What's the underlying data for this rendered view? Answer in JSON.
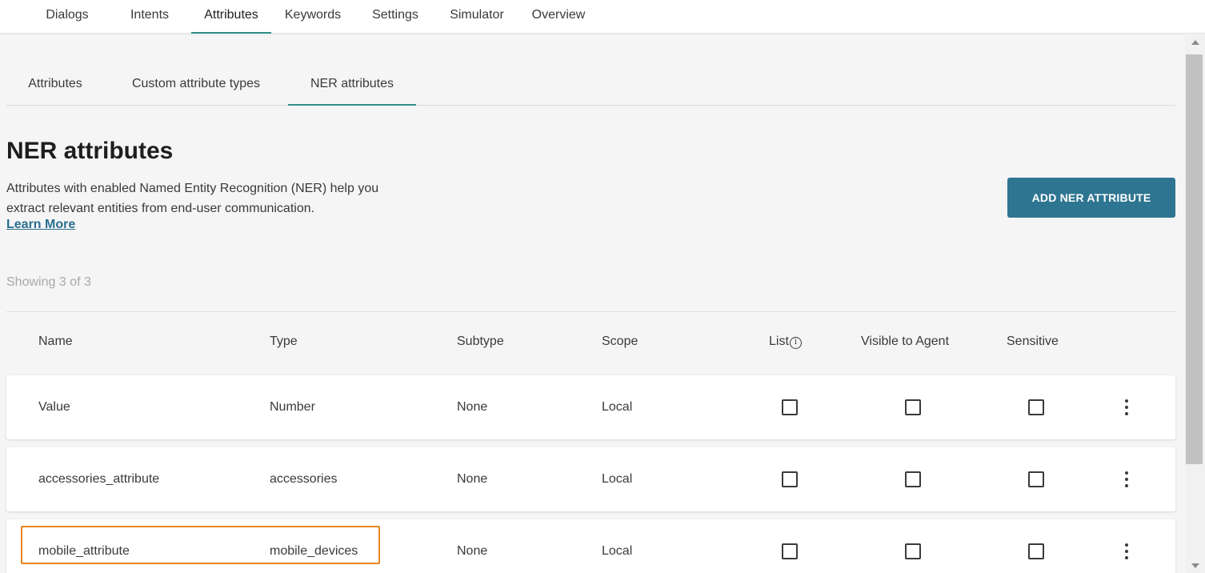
{
  "top_nav": {
    "tabs": [
      {
        "label": "Dialogs"
      },
      {
        "label": "Intents"
      },
      {
        "label": "Attributes"
      },
      {
        "label": "Keywords"
      },
      {
        "label": "Settings"
      },
      {
        "label": "Simulator"
      },
      {
        "label": "Overview"
      }
    ],
    "active": "Attributes"
  },
  "sub_tabs": {
    "tabs": [
      {
        "label": "Attributes"
      },
      {
        "label": "Custom attribute types"
      },
      {
        "label": "NER attributes"
      }
    ],
    "active": "NER attributes"
  },
  "page": {
    "title": "NER attributes",
    "description_line1": "Attributes with enabled Named Entity Recognition (NER) help you",
    "description_line2": "extract relevant entities from end-user communication.",
    "learn_more": "Learn More",
    "add_button": "ADD NER ATTRIBUTE",
    "showing": "Showing 3 of 3"
  },
  "table": {
    "headers": {
      "name": "Name",
      "type": "Type",
      "subtype": "Subtype",
      "scope": "Scope",
      "list": "List",
      "visible": "Visible to Agent",
      "sensitive": "Sensitive"
    },
    "rows": [
      {
        "name": "Value",
        "type": "Number",
        "subtype": "None",
        "scope": "Local",
        "list": false,
        "visible": false,
        "sensitive": false
      },
      {
        "name": "accessories_attribute",
        "type": "accessories",
        "subtype": "None",
        "scope": "Local",
        "list": false,
        "visible": false,
        "sensitive": false
      },
      {
        "name": "mobile_attribute",
        "type": "mobile_devices",
        "subtype": "None",
        "scope": "Local",
        "list": false,
        "visible": false,
        "sensitive": false
      }
    ]
  },
  "colors": {
    "accent": "#2f8f8a",
    "button": "#2e7591",
    "link": "#2a6f8f",
    "highlight": "#e8871e"
  },
  "icons": {
    "info": "info-icon",
    "more": "more-vertical-icon"
  }
}
